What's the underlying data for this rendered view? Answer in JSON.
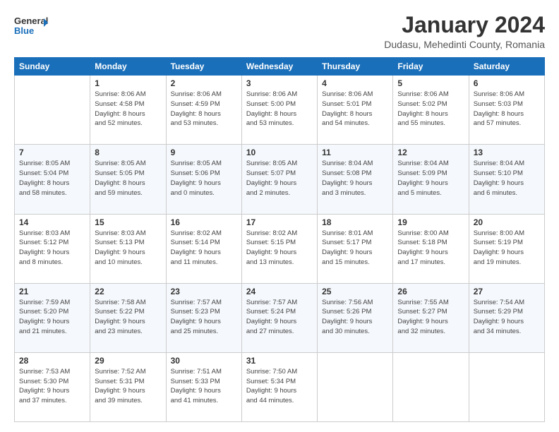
{
  "logo": {
    "line1": "General",
    "line2": "Blue",
    "icon": "▶"
  },
  "title": "January 2024",
  "location": "Dudasu, Mehedinti County, Romania",
  "days_of_week": [
    "Sunday",
    "Monday",
    "Tuesday",
    "Wednesday",
    "Thursday",
    "Friday",
    "Saturday"
  ],
  "weeks": [
    [
      {
        "day": "",
        "info": ""
      },
      {
        "day": "1",
        "info": "Sunrise: 8:06 AM\nSunset: 4:58 PM\nDaylight: 8 hours\nand 52 minutes."
      },
      {
        "day": "2",
        "info": "Sunrise: 8:06 AM\nSunset: 4:59 PM\nDaylight: 8 hours\nand 53 minutes."
      },
      {
        "day": "3",
        "info": "Sunrise: 8:06 AM\nSunset: 5:00 PM\nDaylight: 8 hours\nand 53 minutes."
      },
      {
        "day": "4",
        "info": "Sunrise: 8:06 AM\nSunset: 5:01 PM\nDaylight: 8 hours\nand 54 minutes."
      },
      {
        "day": "5",
        "info": "Sunrise: 8:06 AM\nSunset: 5:02 PM\nDaylight: 8 hours\nand 55 minutes."
      },
      {
        "day": "6",
        "info": "Sunrise: 8:06 AM\nSunset: 5:03 PM\nDaylight: 8 hours\nand 57 minutes."
      }
    ],
    [
      {
        "day": "7",
        "info": "Sunrise: 8:05 AM\nSunset: 5:04 PM\nDaylight: 8 hours\nand 58 minutes."
      },
      {
        "day": "8",
        "info": "Sunrise: 8:05 AM\nSunset: 5:05 PM\nDaylight: 8 hours\nand 59 minutes."
      },
      {
        "day": "9",
        "info": "Sunrise: 8:05 AM\nSunset: 5:06 PM\nDaylight: 9 hours\nand 0 minutes."
      },
      {
        "day": "10",
        "info": "Sunrise: 8:05 AM\nSunset: 5:07 PM\nDaylight: 9 hours\nand 2 minutes."
      },
      {
        "day": "11",
        "info": "Sunrise: 8:04 AM\nSunset: 5:08 PM\nDaylight: 9 hours\nand 3 minutes."
      },
      {
        "day": "12",
        "info": "Sunrise: 8:04 AM\nSunset: 5:09 PM\nDaylight: 9 hours\nand 5 minutes."
      },
      {
        "day": "13",
        "info": "Sunrise: 8:04 AM\nSunset: 5:10 PM\nDaylight: 9 hours\nand 6 minutes."
      }
    ],
    [
      {
        "day": "14",
        "info": "Sunrise: 8:03 AM\nSunset: 5:12 PM\nDaylight: 9 hours\nand 8 minutes."
      },
      {
        "day": "15",
        "info": "Sunrise: 8:03 AM\nSunset: 5:13 PM\nDaylight: 9 hours\nand 10 minutes."
      },
      {
        "day": "16",
        "info": "Sunrise: 8:02 AM\nSunset: 5:14 PM\nDaylight: 9 hours\nand 11 minutes."
      },
      {
        "day": "17",
        "info": "Sunrise: 8:02 AM\nSunset: 5:15 PM\nDaylight: 9 hours\nand 13 minutes."
      },
      {
        "day": "18",
        "info": "Sunrise: 8:01 AM\nSunset: 5:17 PM\nDaylight: 9 hours\nand 15 minutes."
      },
      {
        "day": "19",
        "info": "Sunrise: 8:00 AM\nSunset: 5:18 PM\nDaylight: 9 hours\nand 17 minutes."
      },
      {
        "day": "20",
        "info": "Sunrise: 8:00 AM\nSunset: 5:19 PM\nDaylight: 9 hours\nand 19 minutes."
      }
    ],
    [
      {
        "day": "21",
        "info": "Sunrise: 7:59 AM\nSunset: 5:20 PM\nDaylight: 9 hours\nand 21 minutes."
      },
      {
        "day": "22",
        "info": "Sunrise: 7:58 AM\nSunset: 5:22 PM\nDaylight: 9 hours\nand 23 minutes."
      },
      {
        "day": "23",
        "info": "Sunrise: 7:57 AM\nSunset: 5:23 PM\nDaylight: 9 hours\nand 25 minutes."
      },
      {
        "day": "24",
        "info": "Sunrise: 7:57 AM\nSunset: 5:24 PM\nDaylight: 9 hours\nand 27 minutes."
      },
      {
        "day": "25",
        "info": "Sunrise: 7:56 AM\nSunset: 5:26 PM\nDaylight: 9 hours\nand 30 minutes."
      },
      {
        "day": "26",
        "info": "Sunrise: 7:55 AM\nSunset: 5:27 PM\nDaylight: 9 hours\nand 32 minutes."
      },
      {
        "day": "27",
        "info": "Sunrise: 7:54 AM\nSunset: 5:29 PM\nDaylight: 9 hours\nand 34 minutes."
      }
    ],
    [
      {
        "day": "28",
        "info": "Sunrise: 7:53 AM\nSunset: 5:30 PM\nDaylight: 9 hours\nand 37 minutes."
      },
      {
        "day": "29",
        "info": "Sunrise: 7:52 AM\nSunset: 5:31 PM\nDaylight: 9 hours\nand 39 minutes."
      },
      {
        "day": "30",
        "info": "Sunrise: 7:51 AM\nSunset: 5:33 PM\nDaylight: 9 hours\nand 41 minutes."
      },
      {
        "day": "31",
        "info": "Sunrise: 7:50 AM\nSunset: 5:34 PM\nDaylight: 9 hours\nand 44 minutes."
      },
      {
        "day": "",
        "info": ""
      },
      {
        "day": "",
        "info": ""
      },
      {
        "day": "",
        "info": ""
      }
    ]
  ]
}
